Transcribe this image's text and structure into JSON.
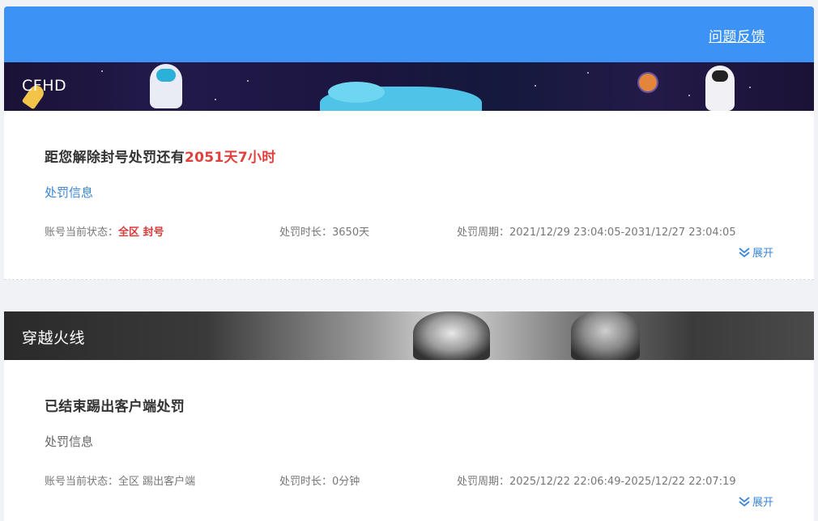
{
  "header": {
    "feedback_label": "问题反馈",
    "bg_color": "#3d92f5"
  },
  "cards": [
    {
      "banner_title": "CFHD",
      "headline_prefix": "距您解除封号处罚还有",
      "headline_highlight": "2051天7小时",
      "section_label": "处罚信息",
      "status_label": "账号当前状态：",
      "status_value": "全区 封号",
      "duration_label": "处罚时长：",
      "duration_value": "3650天",
      "period_label": "处罚周期：",
      "period_value": "2021/12/29 23:04:05-2031/12/27 23:04:05",
      "expand_label": "展开"
    },
    {
      "banner_title": "穿越火线",
      "headline_prefix": "已结束踢出客户端处罚",
      "section_label": "处罚信息",
      "status_label": "账号当前状态：",
      "status_value": "全区 踢出客户端",
      "duration_label": "处罚时长：",
      "duration_value": "0分钟",
      "period_label": "处罚周期：",
      "period_value": "2025/12/22 22:06:49-2025/12/22 22:07:19",
      "expand_label": "展开"
    }
  ],
  "colors": {
    "accent_blue": "#3d92f5",
    "link_blue": "#3a86d6",
    "highlight_red": "#e0413c"
  },
  "icons": [
    "double-chevron-down-icon"
  ]
}
